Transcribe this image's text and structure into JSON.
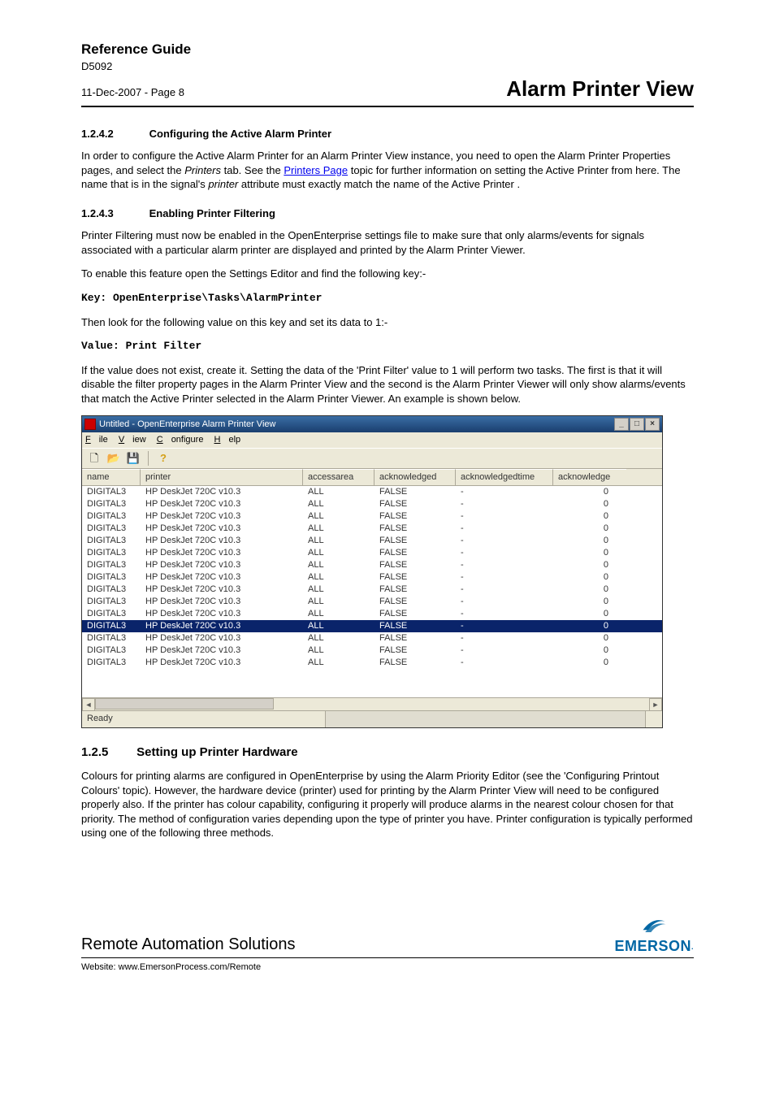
{
  "header": {
    "ref_guide": "Reference Guide",
    "doc_id": "D5092",
    "date_page": "11-Dec-2007 - Page 8",
    "title": "Alarm Printer View"
  },
  "s1": {
    "num": "1.2.4.2",
    "title": "Configuring the Active Alarm Printer",
    "p1a": "In order to configure the Active Alarm Printer for an Alarm Printer View instance, you need to open the Alarm Printer Properties pages, and select the ",
    "p1b_italic": "Printers",
    "p1c": " tab. See the ",
    "p1d_link": "Printers Page",
    "p1e": " topic for further information on setting the Active Printer from here. The name that is in the signal's ",
    "p1f_italic": "printer",
    "p1g": " attribute must exactly match the name of the Active Printer  ."
  },
  "s2": {
    "num": "1.2.4.3",
    "title": "Enabling Printer Filtering",
    "p1": "Printer Filtering must now be enabled in the OpenEnterprise settings file to make sure that only alarms/events for signals associated with a particular alarm printer are displayed and printed by the Alarm Printer Viewer.",
    "p2": "To enable this feature open the Settings Editor and find the following key:-",
    "key": "Key: OpenEnterprise\\Tasks\\AlarmPrinter",
    "p3": "Then look for the following value on this key and set its data to 1:-",
    "value": "Value: Print Filter",
    "p4": "If the value does not exist, create it. Setting the data of the 'Print Filter' value to 1 will perform two tasks. The first is that it will disable the filter property pages in the Alarm Printer View and the second is the Alarm Printer Viewer will only show alarms/events that match the Active Printer selected in the Alarm Printer Viewer. An example is shown below."
  },
  "app": {
    "title": "Untitled - OpenEnterprise Alarm Printer View",
    "menu": {
      "file": "File",
      "view": "View",
      "configure": "Configure",
      "help": "Help"
    },
    "cols": {
      "name": "name",
      "printer": "printer",
      "access": "accessarea",
      "ack": "acknowledged",
      "acktime": "acknowledgedtime",
      "ackn": "acknowledge"
    },
    "rows": [
      {
        "name": "DIGITAL3",
        "printer": "HP DeskJet 720C v10.3",
        "access": "ALL",
        "ack": "FALSE",
        "acktime": "-",
        "ackn": "0",
        "sel": false
      },
      {
        "name": "DIGITAL3",
        "printer": "HP DeskJet 720C v10.3",
        "access": "ALL",
        "ack": "FALSE",
        "acktime": "-",
        "ackn": "0",
        "sel": false
      },
      {
        "name": "DIGITAL3",
        "printer": "HP DeskJet 720C v10.3",
        "access": "ALL",
        "ack": "FALSE",
        "acktime": "-",
        "ackn": "0",
        "sel": false
      },
      {
        "name": "DIGITAL3",
        "printer": "HP DeskJet 720C v10.3",
        "access": "ALL",
        "ack": "FALSE",
        "acktime": "-",
        "ackn": "0",
        "sel": false
      },
      {
        "name": "DIGITAL3",
        "printer": "HP DeskJet 720C v10.3",
        "access": "ALL",
        "ack": "FALSE",
        "acktime": "-",
        "ackn": "0",
        "sel": false
      },
      {
        "name": "DIGITAL3",
        "printer": "HP DeskJet 720C v10.3",
        "access": "ALL",
        "ack": "FALSE",
        "acktime": "-",
        "ackn": "0",
        "sel": false
      },
      {
        "name": "DIGITAL3",
        "printer": "HP DeskJet 720C v10.3",
        "access": "ALL",
        "ack": "FALSE",
        "acktime": "-",
        "ackn": "0",
        "sel": false
      },
      {
        "name": "DIGITAL3",
        "printer": "HP DeskJet 720C v10.3",
        "access": "ALL",
        "ack": "FALSE",
        "acktime": "-",
        "ackn": "0",
        "sel": false
      },
      {
        "name": "DIGITAL3",
        "printer": "HP DeskJet 720C v10.3",
        "access": "ALL",
        "ack": "FALSE",
        "acktime": "-",
        "ackn": "0",
        "sel": false
      },
      {
        "name": "DIGITAL3",
        "printer": "HP DeskJet 720C v10.3",
        "access": "ALL",
        "ack": "FALSE",
        "acktime": "-",
        "ackn": "0",
        "sel": false
      },
      {
        "name": "DIGITAL3",
        "printer": "HP DeskJet 720C v10.3",
        "access": "ALL",
        "ack": "FALSE",
        "acktime": "-",
        "ackn": "0",
        "sel": false
      },
      {
        "name": "DIGITAL3",
        "printer": "HP DeskJet 720C v10.3",
        "access": "ALL",
        "ack": "FALSE",
        "acktime": "-",
        "ackn": "0",
        "sel": true
      },
      {
        "name": "DIGITAL3",
        "printer": "HP DeskJet 720C v10.3",
        "access": "ALL",
        "ack": "FALSE",
        "acktime": "-",
        "ackn": "0",
        "sel": false
      },
      {
        "name": "DIGITAL3",
        "printer": "HP DeskJet 720C v10.3",
        "access": "ALL",
        "ack": "FALSE",
        "acktime": "-",
        "ackn": "0",
        "sel": false
      },
      {
        "name": "DIGITAL3",
        "printer": "HP DeskJet 720C v10.3",
        "access": "ALL",
        "ack": "FALSE",
        "acktime": "-",
        "ackn": "0",
        "sel": false
      }
    ],
    "status": "Ready"
  },
  "s3": {
    "num": "1.2.5",
    "title": "Setting up Printer Hardware",
    "p1": "Colours for printing alarms are configured in OpenEnterprise by using the Alarm Priority Editor (see the 'Configuring Printout Colours' topic). However, the hardware device (printer) used for printing by the Alarm Printer View will need to be configured properly also. If the printer has colour capability, configuring it properly will produce alarms in the nearest colour chosen for that priority. The method of configuration varies depending upon the type of printer you have. Printer configuration is typically performed using one of the following three methods."
  },
  "footer": {
    "company": "Remote Automation Solutions",
    "brand": "EMERSON",
    "website_label": "Website:  www.EmersonProcess.com/Remote"
  }
}
